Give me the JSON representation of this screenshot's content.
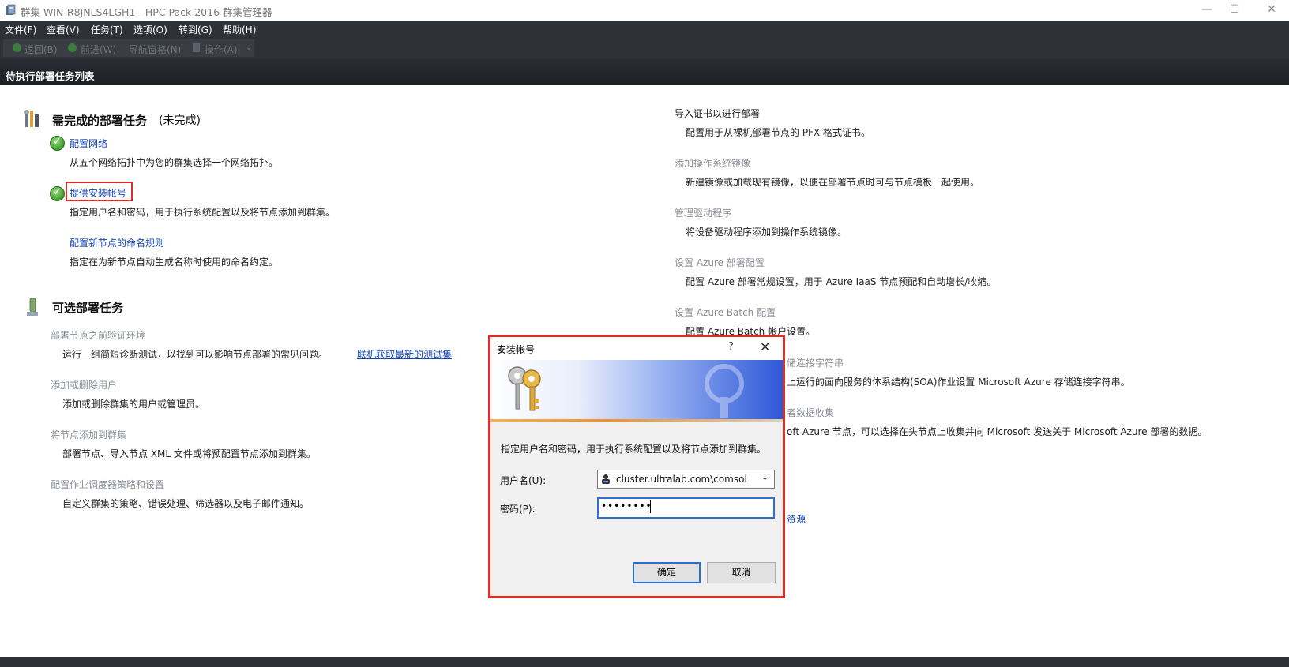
{
  "window": {
    "title": "群集 WIN-R8JNLS4LGH1 - HPC Pack 2016 群集管理器",
    "minimize": "—",
    "maximize": "☐",
    "close": "✕"
  },
  "menu": [
    "文件(F)",
    "查看(V)",
    "任务(T)",
    "选项(O)",
    "转到(G)",
    "帮助(H)"
  ],
  "toolbar": {
    "back": "返回(B)",
    "forward": "前进(W)",
    "nav_pane": "导航窗格(N)",
    "actions": "操作(A)",
    "overflow": "⌄"
  },
  "page_title": "待执行部署任务列表",
  "required": {
    "heading": "需完成的部署任务",
    "status": "(未完成)",
    "tasks": [
      {
        "link": "配置网络",
        "desc": "从五个网络拓扑中为您的群集选择一个网络拓扑。"
      },
      {
        "link": "提供安装帐号",
        "desc": "指定用户名和密码，用于执行系统配置以及将节点添加到群集。"
      },
      {
        "link": "配置新节点的命名规则",
        "desc": "指定在为新节点自动生成名称时使用的命名约定。"
      }
    ]
  },
  "optional": {
    "heading": "可选部署任务",
    "tasks": [
      {
        "title": "部署节点之前验证环境",
        "desc": "运行一组简短诊断测试，以找到可以影响节点部署的常见问题。",
        "extra_link": "联机获取最新的测试集"
      },
      {
        "title": "添加或删除用户",
        "desc": "添加或删除群集的用户或管理员。"
      },
      {
        "title": "将节点添加到群集",
        "desc": "部署节点、导入节点 XML 文件或将预配置节点添加到群集。"
      },
      {
        "title": "配置作业调度器策略和设置",
        "desc": "自定义群集的策略、错误处理、筛选器以及电子邮件通知。"
      }
    ]
  },
  "right_tasks": [
    {
      "title": "导入证书以进行部署",
      "desc": "配置用于从裸机部署节点的 PFX 格式证书。"
    },
    {
      "title": "添加操作系统镜像",
      "desc": "新建镜像或加载现有镜像，以便在部署节点时可与节点模板一起使用。"
    },
    {
      "title": "管理驱动程序",
      "desc": "将设备驱动程序添加到操作系统镜像。"
    },
    {
      "title": "设置 Azure 部署配置",
      "desc": "配置 Azure 部署常规设置，用于 Azure IaaS 节点预配和自动增长/收缩。"
    },
    {
      "title": "设置 Azure Batch 配置",
      "desc": "配置 Azure Batch 帐户设置。"
    },
    {
      "title": "储连接字符串",
      "desc": "上运行的面向服务的体系结构(SOA)作业设置 Microsoft Azure 存储连接字符串。"
    },
    {
      "title": "者数据收集",
      "desc": "oft Azure 节点，可以选择在头节点上收集并向 Microsoft 发送关于 Microsoft Azure 部署的数据。"
    }
  ],
  "right_link_fragment": "资源",
  "dialog": {
    "title": "安装帐号",
    "help": "?",
    "close": "✕",
    "message": "指定用户名和密码，用于执行系统配置以及将节点添加到群集。",
    "username_label": "用户名(U):",
    "username_value": "cluster.ultralab.com\\comsol",
    "password_label": "密码(P):",
    "password_value": "••••••••",
    "ok": "确定",
    "cancel": "取消"
  },
  "colors": {
    "highlight_border": "#d9302a",
    "link": "#1446b8",
    "dark_bar": "#2e3238"
  }
}
